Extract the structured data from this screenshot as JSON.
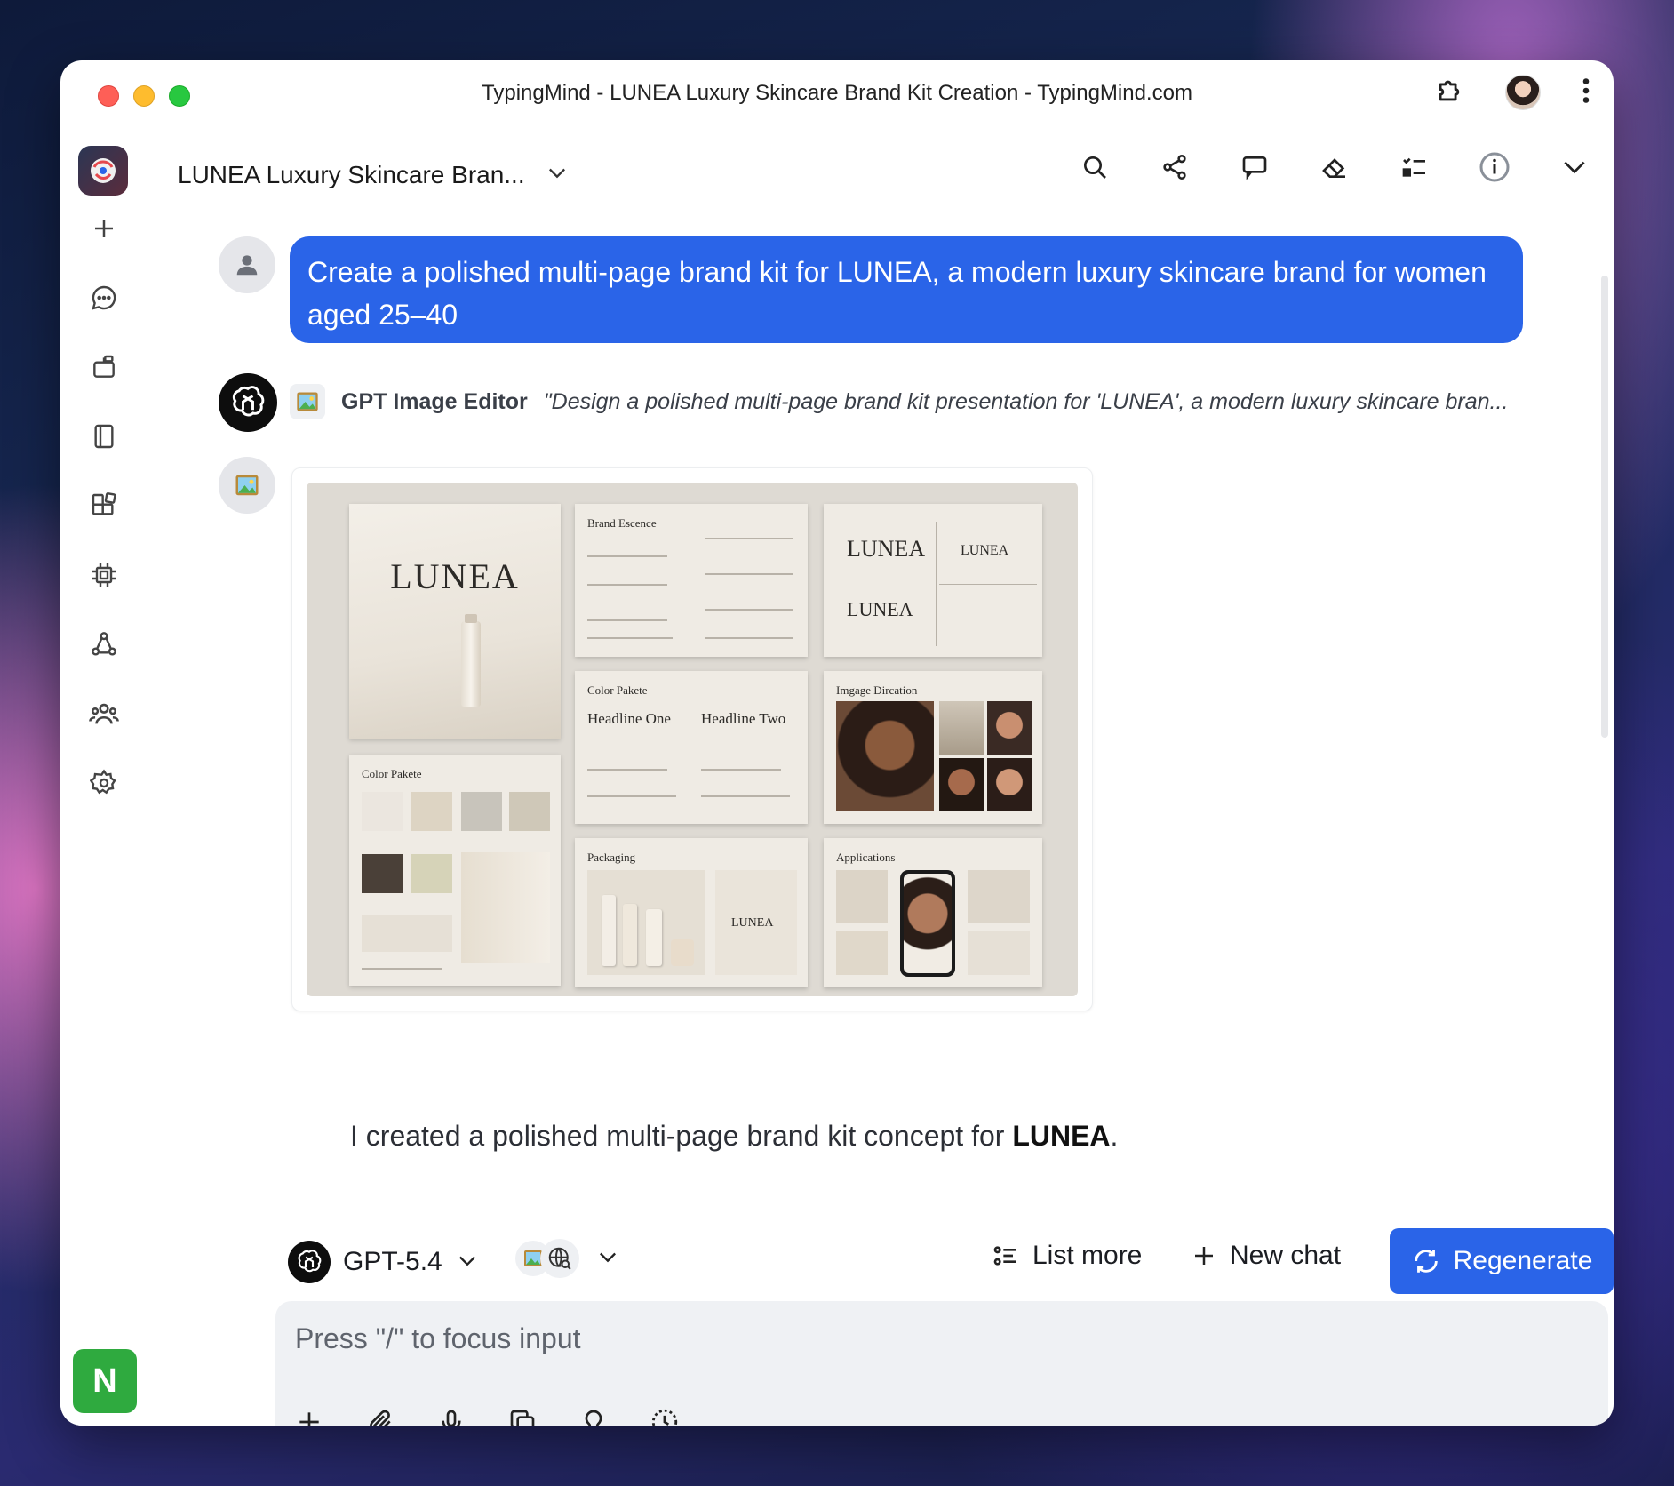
{
  "window": {
    "title": "TypingMind - LUNEA Luxury Skincare Brand Kit Creation - TypingMind.com"
  },
  "header": {
    "chat_title": "LUNEA Luxury Skincare Bran..."
  },
  "messages": {
    "user_text": "Create a polished multi-page brand kit for LUNEA, a modern luxury skincare brand for women aged 25–40",
    "tool_name": "GPT Image Editor",
    "tool_prompt": "\"Design a polished multi-page brand kit presentation for 'LUNEA', a modern luxury skincare bran...",
    "response_prefix": "I created a polished multi-page brand kit concept for ",
    "response_bold": "LUNEA",
    "response_suffix": "."
  },
  "brand_kit_image": {
    "cover_word": "LUNEA",
    "pages": {
      "brand_essence": "Brand Escence",
      "color_palette_1": "Color Pakete",
      "color_palette_2": "Color Pakete",
      "headline_one": "Headline One",
      "headline_two": "Headline Two",
      "imagery": "Imgage Dircation",
      "packaging": "Packaging",
      "applications": "Applications",
      "logo_word": "LUNEA"
    }
  },
  "toolbar": {
    "model_label": "GPT-5.4",
    "list_more": "List more",
    "new_chat": "New chat",
    "regenerate": "Regenerate"
  },
  "composer": {
    "placeholder": "Press \"/\" to focus input"
  },
  "sidebar": {
    "badge_letter": "N"
  },
  "colors": {
    "accent": "#2a64e8",
    "badge_green": "#2faa3f"
  }
}
